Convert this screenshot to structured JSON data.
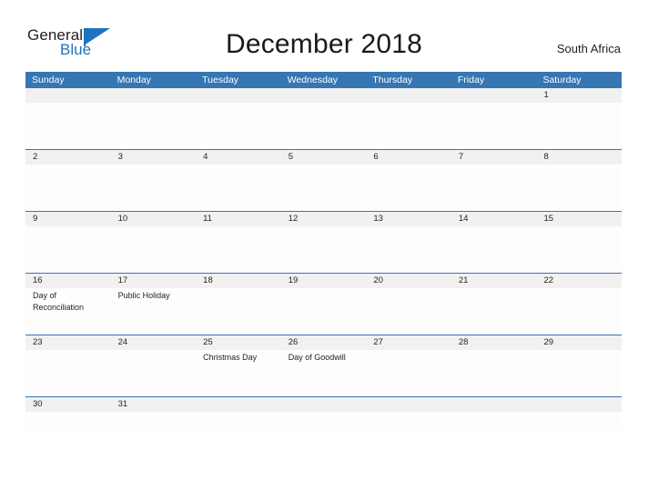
{
  "brand": {
    "line1": "General",
    "line2": "Blue",
    "flag_icon": "blue-triangle-flag-icon",
    "color_dark": "#231f20",
    "color_blue": "#1f72bd"
  },
  "header": {
    "month_title": "December 2018",
    "region": "South Africa"
  },
  "theme": {
    "header_blue": "#3576b3",
    "band_gray": "#f1f1f1",
    "text": "#231f20"
  },
  "weekdays": [
    "Sunday",
    "Monday",
    "Tuesday",
    "Wednesday",
    "Thursday",
    "Friday",
    "Saturday"
  ],
  "weeks": [
    {
      "height": "tall",
      "days": [
        {
          "num": "",
          "event": ""
        },
        {
          "num": "",
          "event": ""
        },
        {
          "num": "",
          "event": ""
        },
        {
          "num": "",
          "event": ""
        },
        {
          "num": "",
          "event": ""
        },
        {
          "num": "",
          "event": ""
        },
        {
          "num": "1",
          "event": ""
        }
      ]
    },
    {
      "height": "tall",
      "days": [
        {
          "num": "2",
          "event": ""
        },
        {
          "num": "3",
          "event": ""
        },
        {
          "num": "4",
          "event": ""
        },
        {
          "num": "5",
          "event": ""
        },
        {
          "num": "6",
          "event": ""
        },
        {
          "num": "7",
          "event": ""
        },
        {
          "num": "8",
          "event": ""
        }
      ]
    },
    {
      "height": "tall",
      "days": [
        {
          "num": "9",
          "event": ""
        },
        {
          "num": "10",
          "event": ""
        },
        {
          "num": "11",
          "event": ""
        },
        {
          "num": "12",
          "event": ""
        },
        {
          "num": "13",
          "event": ""
        },
        {
          "num": "14",
          "event": ""
        },
        {
          "num": "15",
          "event": ""
        }
      ]
    },
    {
      "height": "tall",
      "days": [
        {
          "num": "16",
          "event": "Day of Reconciliation"
        },
        {
          "num": "17",
          "event": "Public Holiday"
        },
        {
          "num": "18",
          "event": ""
        },
        {
          "num": "19",
          "event": ""
        },
        {
          "num": "20",
          "event": ""
        },
        {
          "num": "21",
          "event": ""
        },
        {
          "num": "22",
          "event": ""
        }
      ]
    },
    {
      "height": "tall",
      "days": [
        {
          "num": "23",
          "event": ""
        },
        {
          "num": "24",
          "event": ""
        },
        {
          "num": "25",
          "event": "Christmas Day"
        },
        {
          "num": "26",
          "event": "Day of Goodwill"
        },
        {
          "num": "27",
          "event": ""
        },
        {
          "num": "28",
          "event": ""
        },
        {
          "num": "29",
          "event": ""
        }
      ]
    },
    {
      "height": "short",
      "days": [
        {
          "num": "30",
          "event": ""
        },
        {
          "num": "31",
          "event": ""
        },
        {
          "num": "",
          "event": ""
        },
        {
          "num": "",
          "event": ""
        },
        {
          "num": "",
          "event": ""
        },
        {
          "num": "",
          "event": ""
        },
        {
          "num": "",
          "event": ""
        }
      ]
    }
  ]
}
